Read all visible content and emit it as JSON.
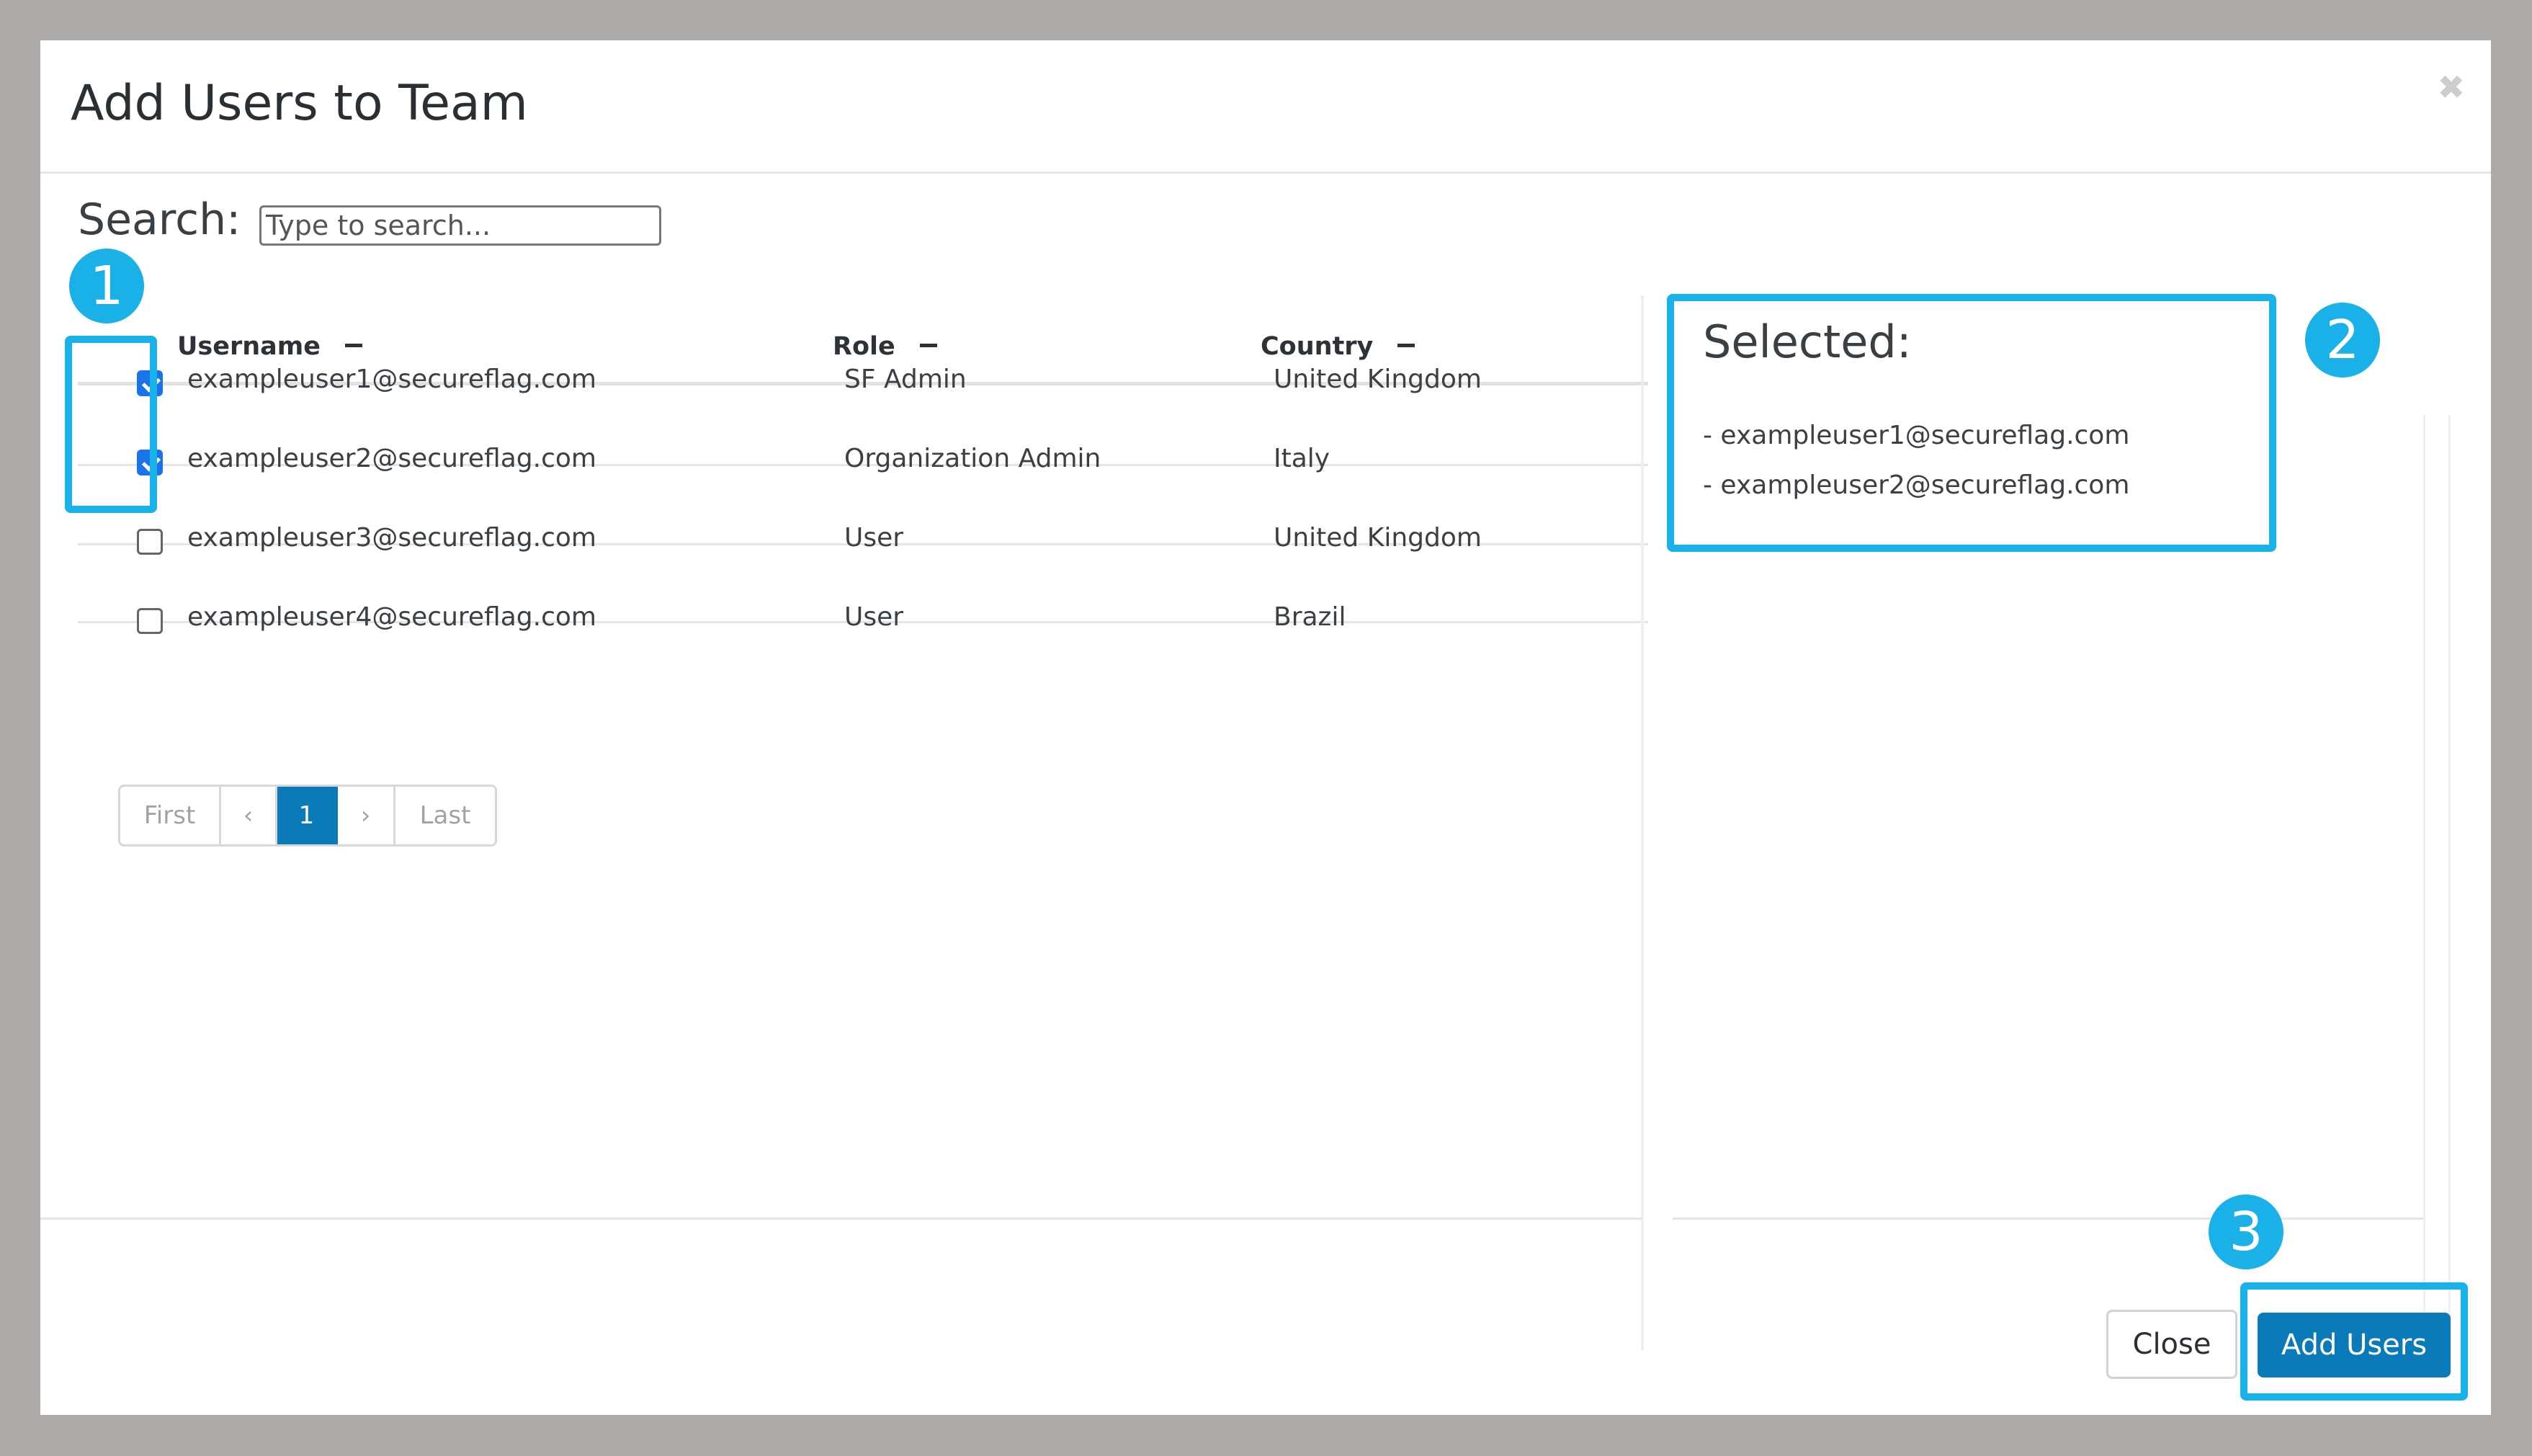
{
  "modal": {
    "title": "Add Users to Team",
    "close_glyph": "✖"
  },
  "search": {
    "label": "Search:",
    "placeholder": "Type to search..."
  },
  "table": {
    "headers": [
      "Username",
      "Role",
      "Country"
    ],
    "rows": [
      {
        "username": "exampleuser1@secureflag.com",
        "role": "SF Admin",
        "country": "United Kingdom",
        "checked": true
      },
      {
        "username": "exampleuser2@secureflag.com",
        "role": "Organization Admin",
        "country": "Italy",
        "checked": true
      },
      {
        "username": "exampleuser3@secureflag.com",
        "role": "User",
        "country": "United Kingdom",
        "checked": false
      },
      {
        "username": "exampleuser4@secureflag.com",
        "role": "User",
        "country": "Brazil",
        "checked": false
      }
    ]
  },
  "pagination": {
    "first": "First",
    "prev": "‹",
    "current": "1",
    "next": "›",
    "last": "Last"
  },
  "selected": {
    "title": "Selected:",
    "items": [
      "- exampleuser1@secureflag.com",
      "- exampleuser2@secureflag.com"
    ]
  },
  "footer": {
    "close_label": "Close",
    "add_label": "Add Users"
  },
  "annotations": {
    "badges": [
      "1",
      "2",
      "3"
    ],
    "color": "#18b1e9"
  },
  "colors": {
    "primary": "#0b7ab8",
    "checkbox": "#1a73e8"
  }
}
